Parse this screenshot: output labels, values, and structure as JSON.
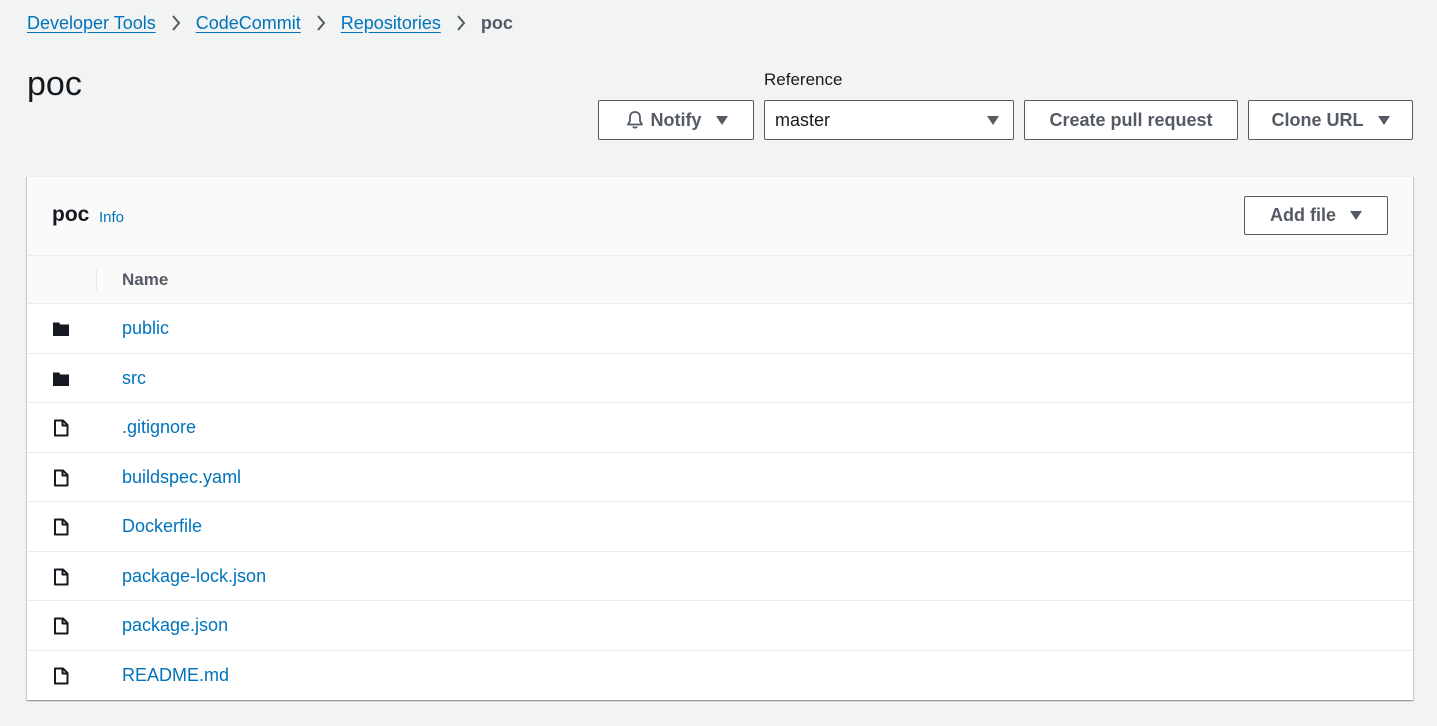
{
  "breadcrumb": {
    "items": [
      "Developer Tools",
      "CodeCommit",
      "Repositories"
    ],
    "current": "poc"
  },
  "page": {
    "title": "poc"
  },
  "toolbar": {
    "notify_label": "Notify",
    "reference_label": "Reference",
    "reference_value": "master",
    "create_pr_label": "Create pull request",
    "clone_url_label": "Clone URL"
  },
  "panel": {
    "title": "poc",
    "info_label": "Info",
    "add_file_label": "Add file",
    "column_name": "Name",
    "files": [
      {
        "name": "public",
        "type": "folder",
        "icon": "folder-icon"
      },
      {
        "name": "src",
        "type": "folder",
        "icon": "folder-icon"
      },
      {
        "name": ".gitignore",
        "type": "file",
        "icon": "file-icon"
      },
      {
        "name": "buildspec.yaml",
        "type": "file",
        "icon": "file-icon"
      },
      {
        "name": "Dockerfile",
        "type": "file",
        "icon": "file-icon"
      },
      {
        "name": "package-lock.json",
        "type": "file",
        "icon": "file-icon"
      },
      {
        "name": "package.json",
        "type": "file",
        "icon": "file-icon"
      },
      {
        "name": "README.md",
        "type": "file",
        "icon": "file-icon"
      }
    ]
  },
  "colors": {
    "link": "#0073bb",
    "text": "#16191f",
    "muted": "#545b64",
    "background": "#f2f3f3",
    "border": "#eaeded"
  }
}
